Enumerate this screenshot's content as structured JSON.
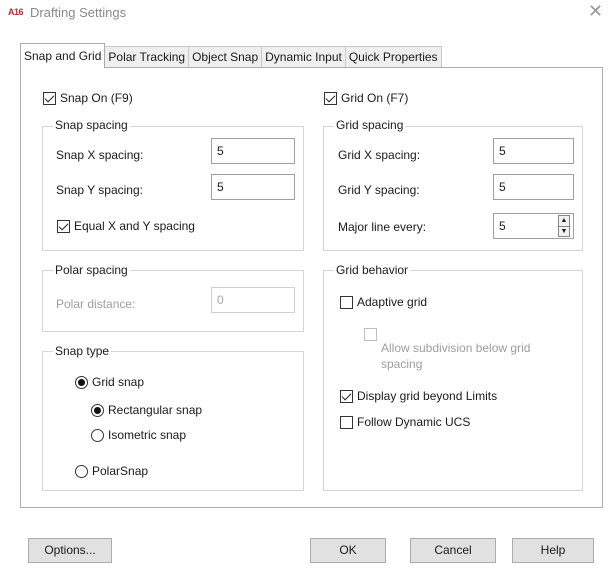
{
  "window": {
    "app_icon_text": "A16",
    "title": "Drafting Settings",
    "close_glyph": "✕"
  },
  "tabs": [
    {
      "label": "Snap and Grid",
      "active": true
    },
    {
      "label": "Polar Tracking",
      "active": false
    },
    {
      "label": "Object Snap",
      "active": false
    },
    {
      "label": "Dynamic Input",
      "active": false
    },
    {
      "label": "Quick Properties",
      "active": false
    }
  ],
  "snap": {
    "snap_on_label": "Snap On (F9)",
    "snap_on_checked": true,
    "spacing": {
      "legend": "Snap spacing",
      "x_label": "Snap X spacing:",
      "x_value": "5",
      "y_label": "Snap Y spacing:",
      "y_value": "5",
      "equal_label": "Equal X and Y spacing",
      "equal_checked": true
    },
    "polar": {
      "legend": "Polar spacing",
      "distance_label": "Polar distance:",
      "distance_value": "0"
    },
    "type": {
      "legend": "Snap type",
      "grid_snap_label": "Grid snap",
      "rectangular_label": "Rectangular snap",
      "isometric_label": "Isometric snap",
      "polarsnap_label": "PolarSnap",
      "selected_main": "Grid snap",
      "selected_sub": "Rectangular snap"
    }
  },
  "grid": {
    "grid_on_label": "Grid On (F7)",
    "grid_on_checked": true,
    "spacing": {
      "legend": "Grid spacing",
      "x_label": "Grid X spacing:",
      "x_value": "5",
      "y_label": "Grid Y spacing:",
      "y_value": "5",
      "major_label": "Major line every:",
      "major_value": "5"
    },
    "behavior": {
      "legend": "Grid behavior",
      "adaptive_label": "Adaptive grid",
      "adaptive_checked": false,
      "subdivision_label_1": "Allow subdivision below grid",
      "subdivision_label_2": "spacing",
      "subdivision_checked": false,
      "beyond_limits_label": "Display grid beyond Limits",
      "beyond_limits_checked": true,
      "follow_ucs_label": "Follow Dynamic UCS",
      "follow_ucs_checked": false
    }
  },
  "buttons": {
    "options": "Options...",
    "ok": "OK",
    "cancel": "Cancel",
    "help": "Help"
  },
  "icons": {
    "app": "autocad-app-icon",
    "close": "close-icon",
    "spin_up": "▲",
    "spin_down": "▼"
  }
}
